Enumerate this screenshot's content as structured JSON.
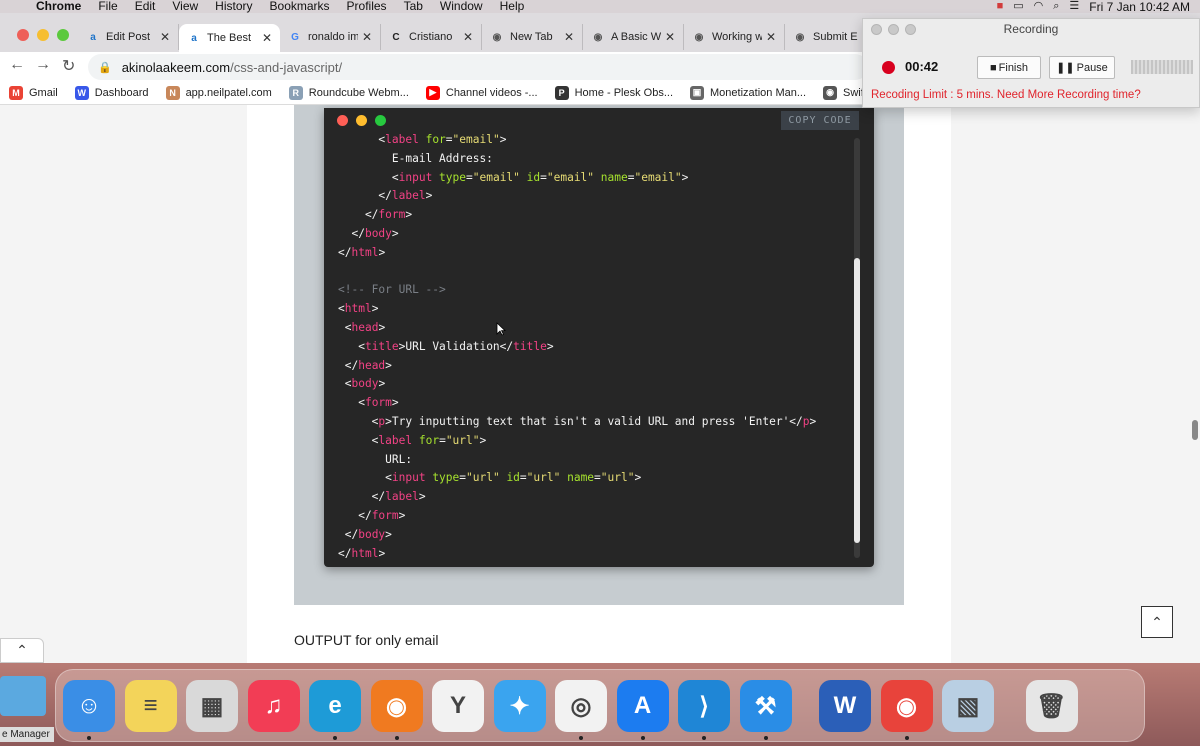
{
  "menubar": {
    "app": "Chrome",
    "items": [
      "File",
      "Edit",
      "View",
      "History",
      "Bookmarks",
      "Profiles",
      "Tab",
      "Window",
      "Help"
    ],
    "datetime": "Fri 7 Jan  10:42 AM"
  },
  "tabs": [
    {
      "label": "Edit Post",
      "favicon": "akinolaakeem-icon",
      "color": "#1d73c9",
      "glyph": "a"
    },
    {
      "label": "The Best",
      "favicon": "akinolaakeem-icon",
      "color": "#1d73c9",
      "glyph": "a",
      "active": true
    },
    {
      "label": "ronaldo im",
      "favicon": "google-icon",
      "color": "#4285f4",
      "glyph": "G"
    },
    {
      "label": "Cristiano",
      "favicon": "chrome-icon",
      "color": "#222222",
      "glyph": "C"
    },
    {
      "label": "New Tab",
      "favicon": "chrome-icon",
      "color": "#555555",
      "glyph": "◉"
    },
    {
      "label": "A Basic W",
      "favicon": "globe-icon",
      "color": "#555555",
      "glyph": "◉"
    },
    {
      "label": "Working w",
      "favicon": "globe-icon",
      "color": "#555555",
      "glyph": "◉"
    },
    {
      "label": "Submit E",
      "favicon": "globe-icon",
      "color": "#555555",
      "glyph": "◉"
    }
  ],
  "address": {
    "host": "akinolaakeem.com",
    "path": "/css-and-javascript/"
  },
  "bookmarks": [
    {
      "label": "Gmail",
      "color": "#ea4335",
      "glyph": "M"
    },
    {
      "label": "Dashboard",
      "color": "#3858e9",
      "glyph": "W"
    },
    {
      "label": "app.neilpatel.com",
      "color": "#c8875a",
      "glyph": "N"
    },
    {
      "label": "Roundcube Webm...",
      "color": "#8aa0b5",
      "glyph": "R"
    },
    {
      "label": "Channel videos -...",
      "color": "#ff0000",
      "glyph": "▶"
    },
    {
      "label": "Home - Plesk Obs...",
      "color": "#333333",
      "glyph": "P"
    },
    {
      "label": "Monetization Man...",
      "color": "#666666",
      "glyph": "▣"
    },
    {
      "label": "Swiftspeed.org",
      "color": "#555555",
      "glyph": "◉"
    }
  ],
  "code": {
    "copy_label": "COPY CODE",
    "lines": [
      [
        [
          "pun",
          "      <"
        ],
        [
          "tag",
          "label"
        ],
        [
          "attr",
          " for"
        ],
        [
          "pun",
          "="
        ],
        [
          "str",
          "\"email\""
        ],
        [
          "pun",
          ">"
        ]
      ],
      [
        [
          "pun",
          "        E-mail Address:"
        ]
      ],
      [
        [
          "pun",
          "        <"
        ],
        [
          "tag",
          "input"
        ],
        [
          "attr",
          " type"
        ],
        [
          "pun",
          "="
        ],
        [
          "str",
          "\"email\""
        ],
        [
          "attr",
          " id"
        ],
        [
          "pun",
          "="
        ],
        [
          "str",
          "\"email\""
        ],
        [
          "attr",
          " name"
        ],
        [
          "pun",
          "="
        ],
        [
          "str",
          "\"email\""
        ],
        [
          "pun",
          ">"
        ]
      ],
      [
        [
          "pun",
          "      </"
        ],
        [
          "tag",
          "label"
        ],
        [
          "pun",
          ">"
        ]
      ],
      [
        [
          "pun",
          "    </"
        ],
        [
          "tag",
          "form"
        ],
        [
          "pun",
          ">"
        ]
      ],
      [
        [
          "pun",
          "  </"
        ],
        [
          "tag",
          "body"
        ],
        [
          "pun",
          ">"
        ]
      ],
      [
        [
          "pun",
          "</"
        ],
        [
          "tag",
          "html"
        ],
        [
          "pun",
          ">"
        ]
      ],
      [
        [
          "pun",
          ""
        ]
      ],
      [
        [
          "com",
          "<!-- For URL -->"
        ]
      ],
      [
        [
          "pun",
          "<"
        ],
        [
          "tag",
          "html"
        ],
        [
          "pun",
          ">"
        ]
      ],
      [
        [
          "pun",
          " <"
        ],
        [
          "tag",
          "head"
        ],
        [
          "pun",
          ">"
        ]
      ],
      [
        [
          "pun",
          "   <"
        ],
        [
          "tag",
          "title"
        ],
        [
          "pun",
          ">URL Validation</"
        ],
        [
          "tag",
          "title"
        ],
        [
          "pun",
          ">"
        ]
      ],
      [
        [
          "pun",
          " </"
        ],
        [
          "tag",
          "head"
        ],
        [
          "pun",
          ">"
        ]
      ],
      [
        [
          "pun",
          " <"
        ],
        [
          "tag",
          "body"
        ],
        [
          "pun",
          ">"
        ]
      ],
      [
        [
          "pun",
          "   <"
        ],
        [
          "tag",
          "form"
        ],
        [
          "pun",
          ">"
        ]
      ],
      [
        [
          "pun",
          "     <"
        ],
        [
          "tag",
          "p"
        ],
        [
          "pun",
          ">Try inputting text that isn't a valid URL and press 'Enter'</"
        ],
        [
          "tag",
          "p"
        ],
        [
          "pun",
          ">"
        ]
      ],
      [
        [
          "pun",
          "     <"
        ],
        [
          "tag",
          "label"
        ],
        [
          "attr",
          " for"
        ],
        [
          "pun",
          "="
        ],
        [
          "str",
          "\"url\""
        ],
        [
          "pun",
          ">"
        ]
      ],
      [
        [
          "pun",
          "       URL:"
        ]
      ],
      [
        [
          "pun",
          "       <"
        ],
        [
          "tag",
          "input"
        ],
        [
          "attr",
          " type"
        ],
        [
          "pun",
          "="
        ],
        [
          "str",
          "\"url\""
        ],
        [
          "attr",
          " id"
        ],
        [
          "pun",
          "="
        ],
        [
          "str",
          "\"url\""
        ],
        [
          "attr",
          " name"
        ],
        [
          "pun",
          "="
        ],
        [
          "str",
          "\"url\""
        ],
        [
          "pun",
          ">"
        ]
      ],
      [
        [
          "pun",
          "     </"
        ],
        [
          "tag",
          "label"
        ],
        [
          "pun",
          ">"
        ]
      ],
      [
        [
          "pun",
          "   </"
        ],
        [
          "tag",
          "form"
        ],
        [
          "pun",
          ">"
        ]
      ],
      [
        [
          "pun",
          " </"
        ],
        [
          "tag",
          "body"
        ],
        [
          "pun",
          ">"
        ]
      ],
      [
        [
          "pun",
          "</"
        ],
        [
          "tag",
          "html"
        ],
        [
          "pun",
          ">"
        ]
      ]
    ]
  },
  "page": {
    "output_label": "OUTPUT for only email"
  },
  "recording": {
    "title": "Recording",
    "time": "00:42",
    "finish_label": "Finish",
    "pause_label": "Pause",
    "limit_text": "Recoding Limit : 5 mins. Need More Recording time?",
    "accent": "#d8001e"
  },
  "dock": {
    "manager_label": "e Manager",
    "apps": [
      {
        "name": "finder-icon",
        "color": "#3a8ee6",
        "glyph": "☺",
        "running": true
      },
      {
        "name": "notes-icon",
        "color": "#f3d45a",
        "glyph": "≡",
        "running": false
      },
      {
        "name": "launchpad-icon",
        "color": "#d9d9d9",
        "glyph": "▦",
        "running": false
      },
      {
        "name": "music-icon",
        "color": "#f23d55",
        "glyph": "♫",
        "running": false
      },
      {
        "name": "edge-icon",
        "color": "#1e9bd7",
        "glyph": "e",
        "running": true
      },
      {
        "name": "firefox-icon",
        "color": "#f07a20",
        "glyph": "◉",
        "running": true
      },
      {
        "name": "yandex-icon",
        "color": "#f2f2f2",
        "glyph": "Y",
        "running": false
      },
      {
        "name": "safari-icon",
        "color": "#3aa4ef",
        "glyph": "✦",
        "running": false
      },
      {
        "name": "chrome-icon",
        "color": "#f2f2f2",
        "glyph": "◎",
        "running": true
      },
      {
        "name": "app-store-icon",
        "color": "#1c7cf0",
        "glyph": "A",
        "running": true
      },
      {
        "name": "vscode-icon",
        "color": "#1f86d6",
        "glyph": "⟩",
        "running": true
      },
      {
        "name": "xcode-icon",
        "color": "#2a8de6",
        "glyph": "⚒",
        "running": true
      },
      {
        "name": "word-icon",
        "color": "#2b5fb8",
        "glyph": "W",
        "running": false
      },
      {
        "name": "recorder-icon",
        "color": "#e8433b",
        "glyph": "◉",
        "running": true
      },
      {
        "name": "preview-icon",
        "color": "#b9cfe3",
        "glyph": "▧",
        "running": false
      },
      {
        "name": "trash-icon",
        "color": "#e6e6e6",
        "glyph": "🗑",
        "running": false
      }
    ]
  }
}
